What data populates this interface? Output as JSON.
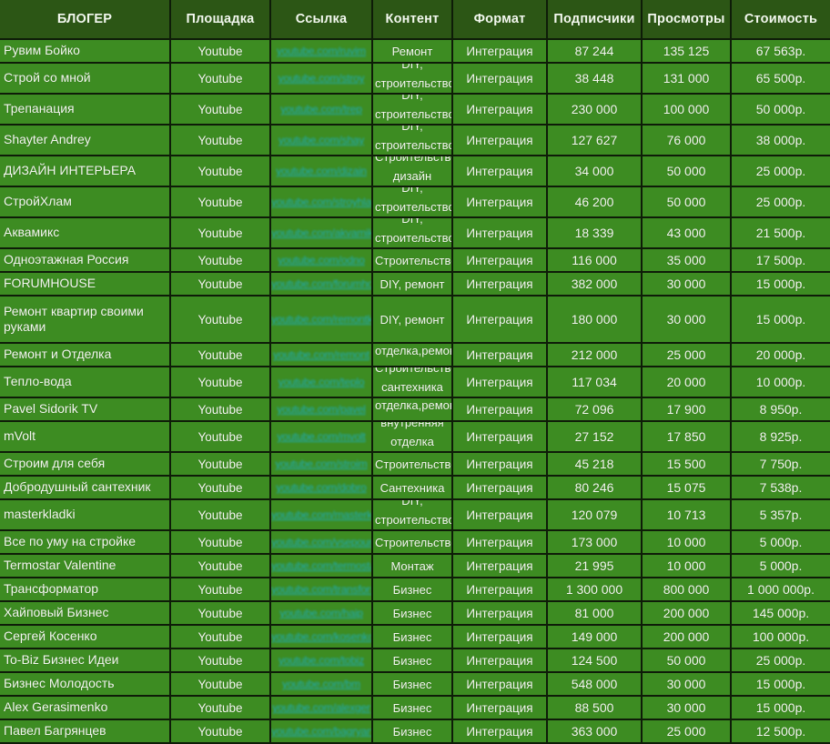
{
  "table": {
    "headers": [
      "БЛОГЕР",
      "Площадка",
      "Ссылка",
      "Контент",
      "Формат",
      "Подписчики",
      "Просмотры",
      "Стоимость"
    ],
    "link_placeholder": "youtube.com/chan",
    "colors": {
      "header_bg": "#2c5615",
      "row_bg": "#3d8c22",
      "grid_line": "#0e1c08",
      "text": "#f4f8f0",
      "link": "#2aa8bb"
    },
    "rows": [
      {
        "blogger": "Рувим Бойко",
        "platform": "Youtube",
        "link": "youtube.com/ruvim",
        "content": "Ремонт",
        "format": "Интеграция",
        "subscribers": "87 244",
        "views": "135 125",
        "price": "67 563р.",
        "tall": false,
        "wrap": false
      },
      {
        "blogger": "Строй со мной",
        "platform": "Youtube",
        "link": "youtube.com/stroy",
        "content": "DIY, строительство",
        "format": "Интеграция",
        "subscribers": "38 448",
        "views": "131 000",
        "price": "65 500р.",
        "tall": false,
        "wrap": true
      },
      {
        "blogger": "Трепанация",
        "platform": "Youtube",
        "link": "youtube.com/trep",
        "content": "DIY, строительство",
        "format": "Интеграция",
        "subscribers": "230 000",
        "views": "100 000",
        "price": "50 000р.",
        "tall": false,
        "wrap": true
      },
      {
        "blogger": "Shayter Andrey",
        "platform": "Youtube",
        "link": "youtube.com/shay",
        "content": "DIY, строительство",
        "format": "Интеграция",
        "subscribers": "127 627",
        "views": "76 000",
        "price": "38 000р.",
        "tall": false,
        "wrap": true
      },
      {
        "blogger": "ДИЗАЙН ИНТЕРЬЕРА",
        "platform": "Youtube",
        "link": "youtube.com/dizain",
        "content": "Строительство, дизайн",
        "format": "Интеграция",
        "subscribers": "34 000",
        "views": "50 000",
        "price": "25 000р.",
        "tall": false,
        "wrap": true
      },
      {
        "blogger": "СтройХлам",
        "platform": "Youtube",
        "link": "youtube.com/stroyhlam",
        "content": "DIY, строительство",
        "format": "Интеграция",
        "subscribers": "46 200",
        "views": "50 000",
        "price": "25 000р.",
        "tall": false,
        "wrap": true
      },
      {
        "blogger": "Аквамикс",
        "platform": "Youtube",
        "link": "youtube.com/akvamiks",
        "content": "DIY, строительство",
        "format": "Интеграция",
        "subscribers": "18 339",
        "views": "43 000",
        "price": "21 500р.",
        "tall": false,
        "wrap": true
      },
      {
        "blogger": "Одноэтажная Россия",
        "platform": "Youtube",
        "link": "youtube.com/odno",
        "content": "Строительство",
        "format": "Интеграция",
        "subscribers": "116 000",
        "views": "35 000",
        "price": "17 500р.",
        "tall": false,
        "wrap": false
      },
      {
        "blogger": "FORUMHOUSE",
        "platform": "Youtube",
        "link": "youtube.com/forumhouse",
        "content": "DIY, ремонт",
        "format": "Интеграция",
        "subscribers": "382 000",
        "views": "30 000",
        "price": "15 000р.",
        "tall": false,
        "wrap": false
      },
      {
        "blogger": "Ремонт квартир своими руками",
        "platform": "Youtube",
        "link": "youtube.com/remontkv",
        "content": "DIY, ремонт",
        "format": "Интеграция",
        "subscribers": "180 000",
        "views": "30 000",
        "price": "15 000р.",
        "tall": true,
        "wrap": false
      },
      {
        "blogger": "Ремонт и Отделка",
        "platform": "Youtube",
        "link": "youtube.com/remont",
        "content": "отделка,ремонт",
        "format": "Интеграция",
        "subscribers": "212 000",
        "views": "25 000",
        "price": "20 000р.",
        "tall": false,
        "wrap": true
      },
      {
        "blogger": "Тепло-вода",
        "platform": "Youtube",
        "link": "youtube.com/teplo",
        "content": "Строительство, сантехника",
        "format": "Интеграция",
        "subscribers": "117 034",
        "views": "20 000",
        "price": "10 000р.",
        "tall": false,
        "wrap": true
      },
      {
        "blogger": "Pavel Sidorik TV",
        "platform": "Youtube",
        "link": "youtube.com/pavel",
        "content": "отделка,ремонт",
        "format": "Интеграция",
        "subscribers": "72 096",
        "views": "17 900",
        "price": "8 950р.",
        "tall": false,
        "wrap": true
      },
      {
        "blogger": "mVolt",
        "platform": "Youtube",
        "link": "youtube.com/mvolt",
        "content": "внутренняя отделка",
        "format": "Интеграция",
        "subscribers": "27 152",
        "views": "17 850",
        "price": "8 925р.",
        "tall": false,
        "wrap": true
      },
      {
        "blogger": "Строим для себя",
        "platform": "Youtube",
        "link": "youtube.com/stroim",
        "content": "Строительство",
        "format": "Интеграция",
        "subscribers": "45 218",
        "views": "15 500",
        "price": "7 750р.",
        "tall": false,
        "wrap": false
      },
      {
        "blogger": "Добродушный сантехник",
        "platform": "Youtube",
        "link": "youtube.com/dobro",
        "content": "Сантехника",
        "format": "Интеграция",
        "subscribers": "80 246",
        "views": "15 075",
        "price": "7 538р.",
        "tall": false,
        "wrap": false
      },
      {
        "blogger": "masterkladki",
        "platform": "Youtube",
        "link": "youtube.com/masterkl",
        "content": "DIY, строительство",
        "format": "Интеграция",
        "subscribers": "120 079",
        "views": "10 713",
        "price": "5 357р.",
        "tall": false,
        "wrap": true
      },
      {
        "blogger": "Все по уму на стройке",
        "platform": "Youtube",
        "link": "youtube.com/vsepoumu",
        "content": "Строительство",
        "format": "Интеграция",
        "subscribers": "173 000",
        "views": "10 000",
        "price": "5 000р.",
        "tall": false,
        "wrap": false
      },
      {
        "blogger": "Termostar Valentine",
        "platform": "Youtube",
        "link": "youtube.com/termostar",
        "content": "Монтаж",
        "format": "Интеграция",
        "subscribers": "21 995",
        "views": "10 000",
        "price": "5 000р.",
        "tall": false,
        "wrap": false
      },
      {
        "blogger": "Трансформатор",
        "platform": "Youtube",
        "link": "youtube.com/transformator",
        "content": "Бизнес",
        "format": "Интеграция",
        "subscribers": "1 300 000",
        "views": "800 000",
        "price": "1 000 000р.",
        "tall": false,
        "wrap": false
      },
      {
        "blogger": "Хайповый Бизнес",
        "platform": "Youtube",
        "link": "youtube.com/haip",
        "content": "Бизнес",
        "format": "Интеграция",
        "subscribers": "81 000",
        "views": "200 000",
        "price": "145 000р.",
        "tall": false,
        "wrap": false
      },
      {
        "blogger": "Сергей Косенко",
        "platform": "Youtube",
        "link": "youtube.com/kosenko",
        "content": "Бизнес",
        "format": "Интеграция",
        "subscribers": "149 000",
        "views": "200 000",
        "price": "100 000р.",
        "tall": false,
        "wrap": false
      },
      {
        "blogger": "To-Biz Бизнес Идеи",
        "platform": "Youtube",
        "link": "youtube.com/tobiz",
        "content": "Бизнес",
        "format": "Интеграция",
        "subscribers": "124 500",
        "views": "50 000",
        "price": "25 000р.",
        "tall": false,
        "wrap": false
      },
      {
        "blogger": "Бизнес Молодость",
        "platform": "Youtube",
        "link": "youtube.com/bm",
        "content": "Бизнес",
        "format": "Интеграция",
        "subscribers": "548 000",
        "views": "30 000",
        "price": "15 000р.",
        "tall": false,
        "wrap": false
      },
      {
        "blogger": "Alex Gerasimenko",
        "platform": "Youtube",
        "link": "youtube.com/alexger",
        "content": "Бизнес",
        "format": "Интеграция",
        "subscribers": "88 500",
        "views": "30 000",
        "price": "15 000р.",
        "tall": false,
        "wrap": false
      },
      {
        "blogger": "Павел Багрянцев",
        "platform": "Youtube",
        "link": "youtube.com/bagryancev",
        "content": "Бизнес",
        "format": "Интеграция",
        "subscribers": "363 000",
        "views": "25 000",
        "price": "12 500р.",
        "tall": false,
        "wrap": false
      }
    ]
  }
}
